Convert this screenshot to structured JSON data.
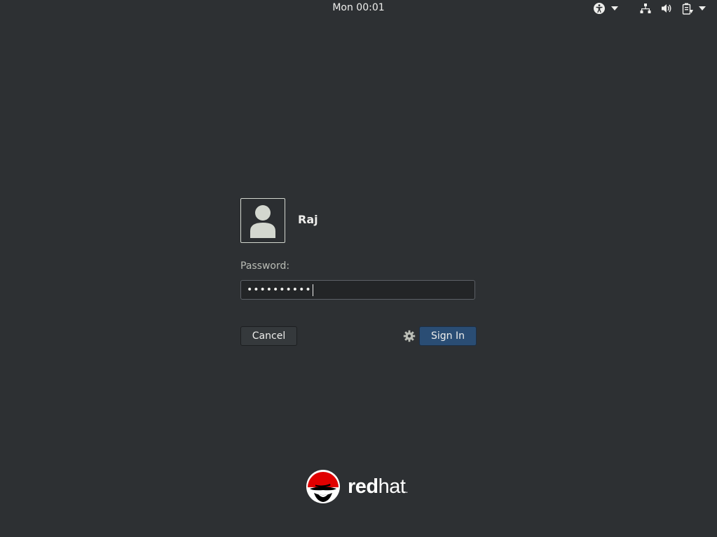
{
  "topbar": {
    "clock": "Mon 00:01",
    "icons": [
      "accessibility-icon",
      "chevron-down-icon",
      "network-icon",
      "volume-icon",
      "battery-icon",
      "chevron-down-icon"
    ]
  },
  "login": {
    "username": "Raj",
    "password_label": "Password:",
    "password_value": "••••••••••",
    "cancel_label": "Cancel",
    "signin_label": "Sign In"
  },
  "brand": {
    "part1": "red",
    "part2": "hat",
    "mark": "."
  },
  "colors": {
    "background": "#2d3033",
    "signin_button": "#2a4d74",
    "brand_red": "#e00000"
  }
}
